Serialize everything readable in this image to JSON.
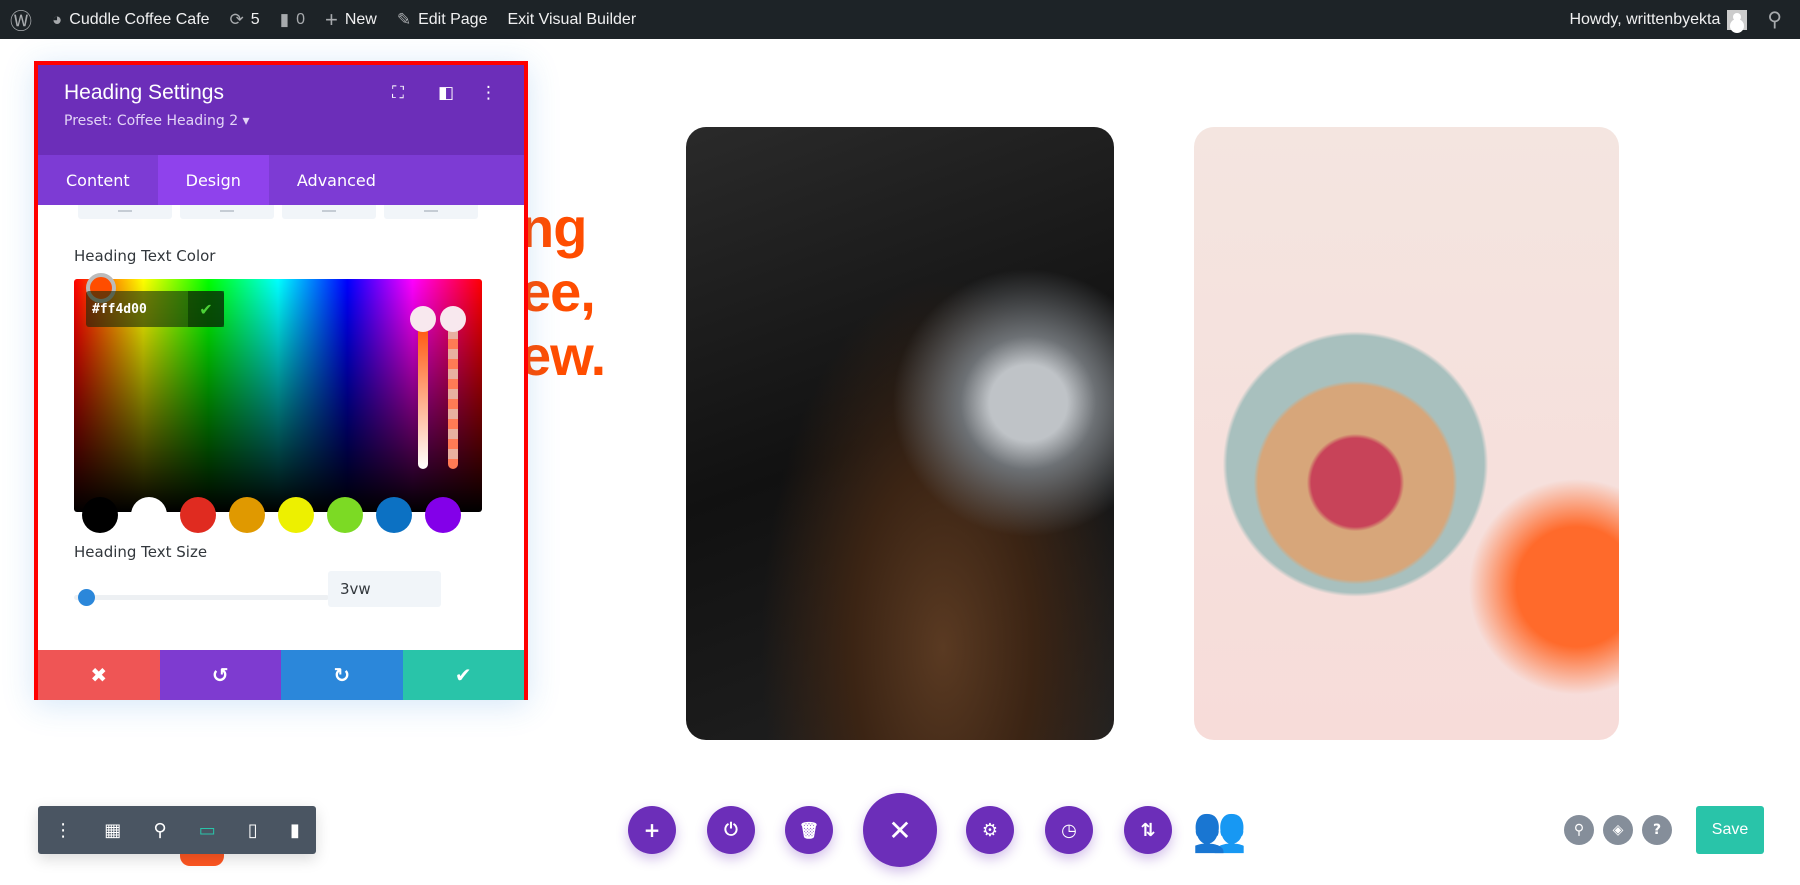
{
  "admin_bar": {
    "site_name": "Cuddle Coffee Cafe",
    "updates_count": "5",
    "comments_count": "0",
    "new_label": "New",
    "edit_page_label": "Edit Page",
    "exit_builder_label": "Exit Visual Builder",
    "greeting": "Howdy, writtenbyekta"
  },
  "page": {
    "heading_fragments": [
      "ng",
      "ee,",
      "ew."
    ]
  },
  "panel": {
    "title": "Heading Settings",
    "preset": "Preset: Coffee Heading 2 ▾",
    "tabs": [
      {
        "label": "Content",
        "active": false
      },
      {
        "label": "Design",
        "active": true
      },
      {
        "label": "Advanced",
        "active": false
      }
    ],
    "text_color_label": "Heading Text Color",
    "hex_value": "#ff4d00",
    "swatches": [
      "#000000",
      "#ffffff",
      "#e02b20",
      "#e09900",
      "#edf000",
      "#7cda24",
      "#0c71c3",
      "#8300e9"
    ],
    "text_size_label": "Heading Text Size",
    "text_size_value": "3vw",
    "footer": {
      "cancel": "✖",
      "undo": "↺",
      "redo": "↻",
      "save": "✔"
    }
  },
  "colors": {
    "accent": "#6c2eb9",
    "heading": "#ff4d00",
    "cancel": "#ef5555",
    "redo": "#2b87da",
    "save": "#29c4a9",
    "highlight_border": "#ff0000"
  },
  "bottom_bar": {
    "save_label": "Save",
    "help_label": "?"
  }
}
